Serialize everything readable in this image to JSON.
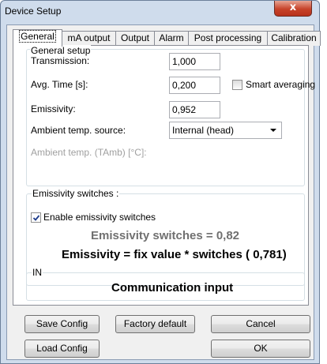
{
  "window": {
    "title": "Device Setup",
    "close_glyph": "x"
  },
  "tabs": [
    {
      "label": "General"
    },
    {
      "label": "mA output"
    },
    {
      "label": "Output"
    },
    {
      "label": "Alarm"
    },
    {
      "label": "Post processing"
    },
    {
      "label": "Calibration"
    }
  ],
  "general_setup": {
    "legend": "General setup",
    "transmission": {
      "label": "Transmission:",
      "value": "1,000"
    },
    "avg_time": {
      "label": "Avg. Time [s]:",
      "value": "0,200"
    },
    "smart_averaging": {
      "label": "Smart averaging",
      "checked": false
    },
    "emissivity": {
      "label": "Emissivity:",
      "value": "0,952"
    },
    "ambient_source": {
      "label": "Ambient temp. source:",
      "value": "Internal (head)"
    },
    "ambient_temp": {
      "label": "Ambient temp. (TAmb) [°C]:"
    }
  },
  "emissivity_switches": {
    "legend": "Emissivity switches :",
    "enable_label": "Enable emissivity switches",
    "enabled": true,
    "switches_text": "Emissivity switches = 0,82",
    "formula_text": "Emissivity = fix value * switches ( 0,781)"
  },
  "input_group": {
    "legend": "IN",
    "text": "Communication input"
  },
  "buttons": {
    "save_config": "Save Config",
    "factory_default": "Factory default",
    "cancel": "Cancel",
    "load_config": "Load Config",
    "ok": "OK"
  }
}
